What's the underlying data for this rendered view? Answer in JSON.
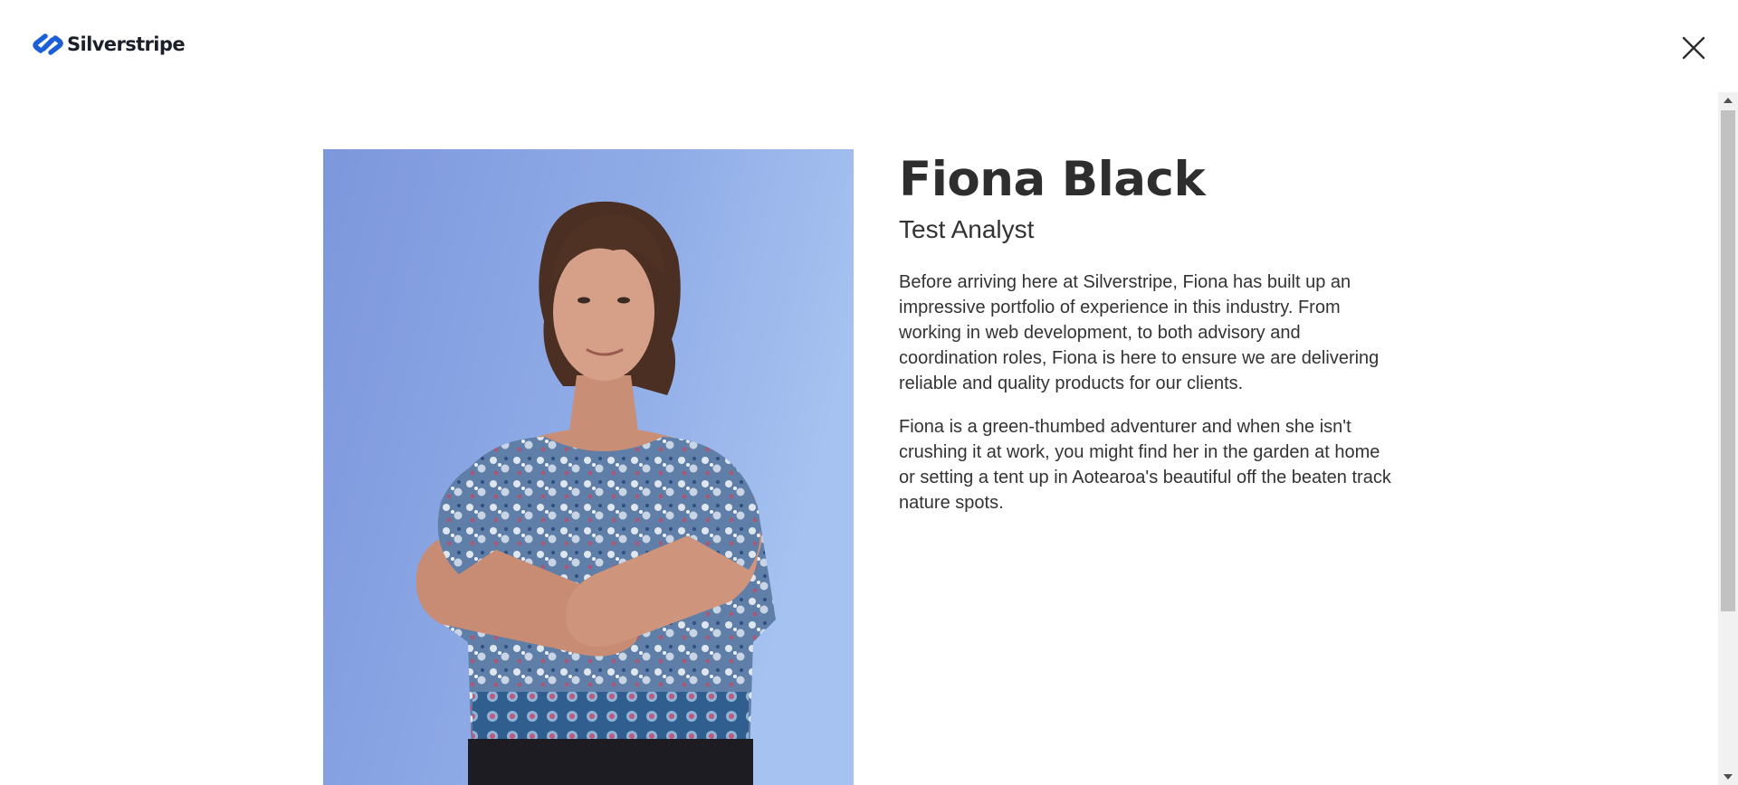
{
  "header": {
    "logo_text": "Silverstripe",
    "logo_icon": "silverstripe-logo-icon",
    "close_icon": "close-icon"
  },
  "profile": {
    "name": "Fiona Black",
    "role": "Test Analyst",
    "bio": [
      "Before arriving here at Silverstripe, Fiona has built up an impressive portfolio of experience in this industry. From working in web development, to both advisory and coordination roles, Fiona is here to ensure we are delivering reliable and quality products for our clients.",
      "Fiona is a green-thumbed adventurer and when she isn't crushing it at work, you might find her in the garden at home or setting a tent up in Aotearoa's beautiful off the beaten track nature spots."
    ]
  },
  "colors": {
    "brand_blue": "#1b5fd6",
    "text": "#333333",
    "photo_background": "#8fabe6"
  }
}
